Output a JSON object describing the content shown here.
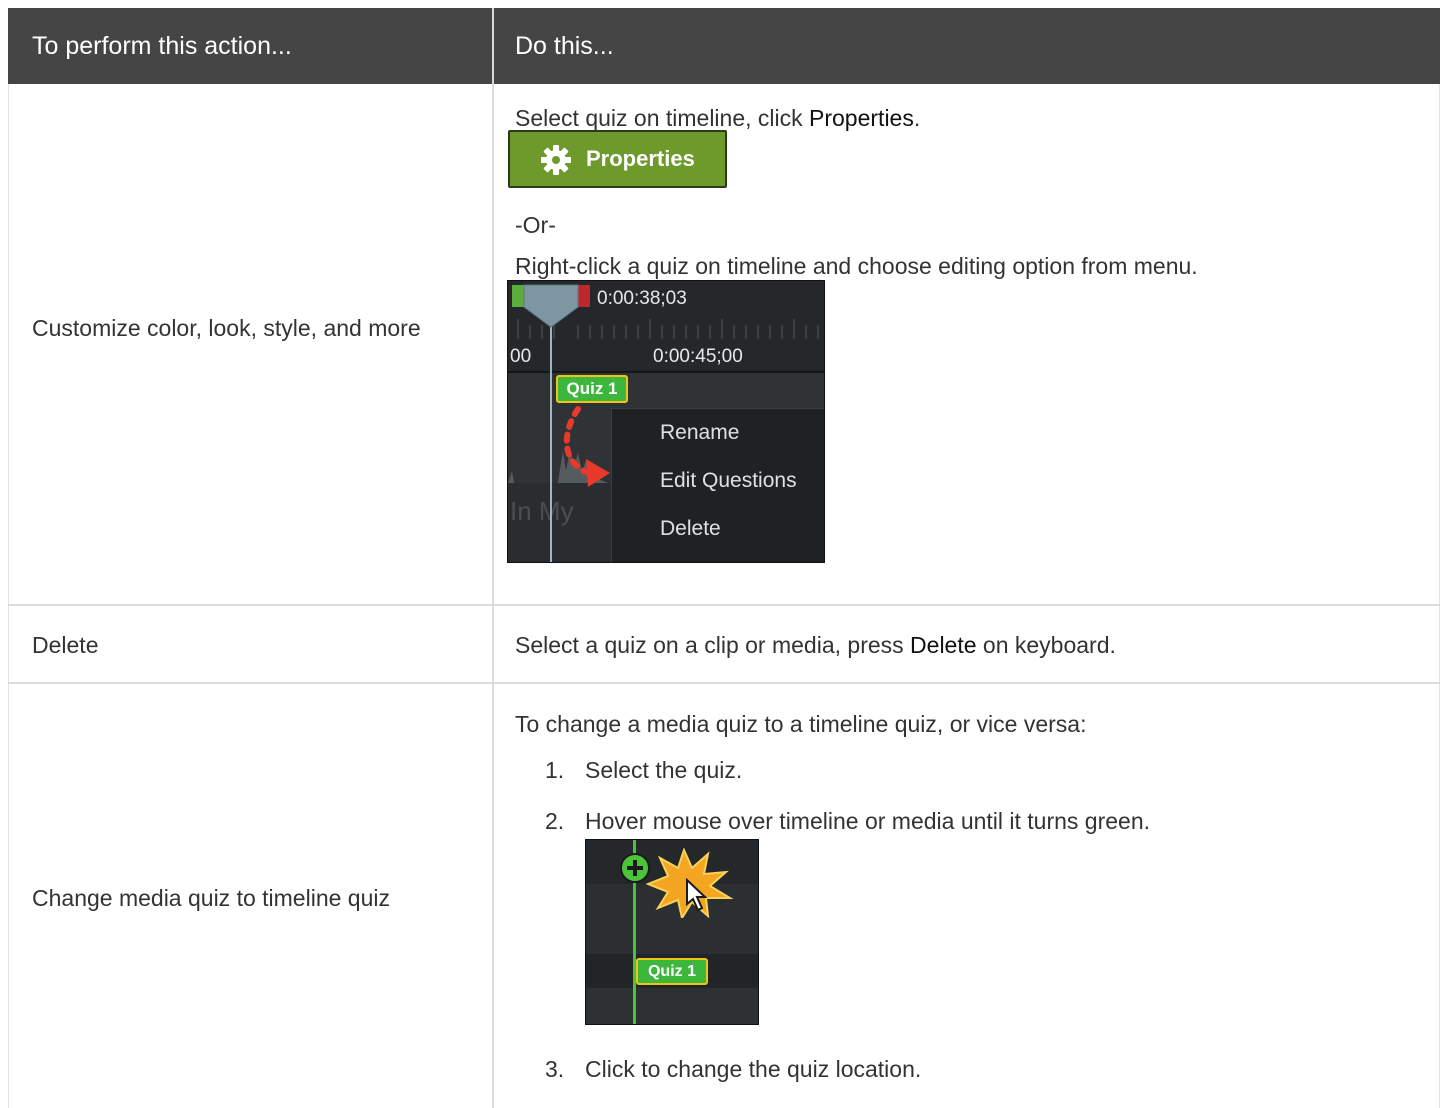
{
  "header": {
    "col1": "To perform this action...",
    "col2": "Do this..."
  },
  "rows": [
    {
      "action": "Customize color, look, style, and more",
      "line1_pre": "Select quiz on timeline, click ",
      "line1_bold": "Properties",
      "line1_post": ".",
      "button_label": "Properties",
      "or_text": "-Or-",
      "line2": "Right-click a quiz on timeline and choose editing option from menu.",
      "screenshot": {
        "time_top": "0:00:38;03",
        "time_left": "00",
        "time_mid": "0:00:45;00",
        "quiz_tag": "Quiz 1",
        "menu_items": [
          "Rename",
          "Edit Questions",
          "Delete"
        ],
        "bg_text": "In My"
      }
    },
    {
      "action": "Delete",
      "line_pre": "Select a quiz on a clip or media, press ",
      "line_bold": "Delete",
      "line_post": " on keyboard."
    },
    {
      "action": "Change media quiz to timeline quiz",
      "intro": "To change a media quiz to a timeline quiz, or vice versa:",
      "steps": [
        {
          "num": "1.",
          "text": "Select the quiz."
        },
        {
          "num": "2.",
          "text": "Hover mouse over timeline or media until it turns green."
        },
        {
          "num": "3.",
          "text": "Click to change the quiz location."
        }
      ],
      "screenshot": {
        "quiz_tag": "Quiz 1"
      }
    }
  ],
  "colors": {
    "header_bg": "#454545",
    "button_green": "#6e9a2c",
    "quiz_green": "#3cb73c",
    "quiz_border": "#f0c419",
    "arrow_red": "#e8392b"
  }
}
